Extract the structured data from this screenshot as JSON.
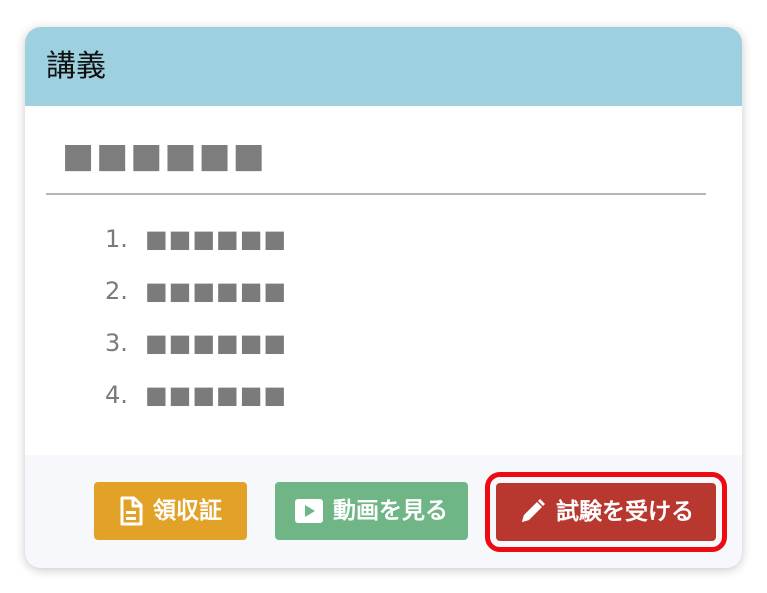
{
  "card": {
    "title": "講義"
  },
  "lecture": {
    "title": "■■■■■■",
    "items": [
      {
        "number": "1.",
        "text": "■■■■■■"
      },
      {
        "number": "2.",
        "text": "■■■■■■"
      },
      {
        "number": "3.",
        "text": "■■■■■■"
      },
      {
        "number": "4.",
        "text": "■■■■■■"
      }
    ]
  },
  "actions": {
    "receipt_label": "領収証",
    "video_label": "動画を見る",
    "exam_label": "試験を受ける"
  },
  "colors": {
    "header_bg": "#9ed1df",
    "receipt_button": "#e2a228",
    "video_button": "#6fb585",
    "exam_button": "#b8382f",
    "highlight_outline": "#ee0a10"
  },
  "icons": {
    "receipt": "document-icon",
    "video": "play-icon",
    "exam": "pencil-icon"
  }
}
